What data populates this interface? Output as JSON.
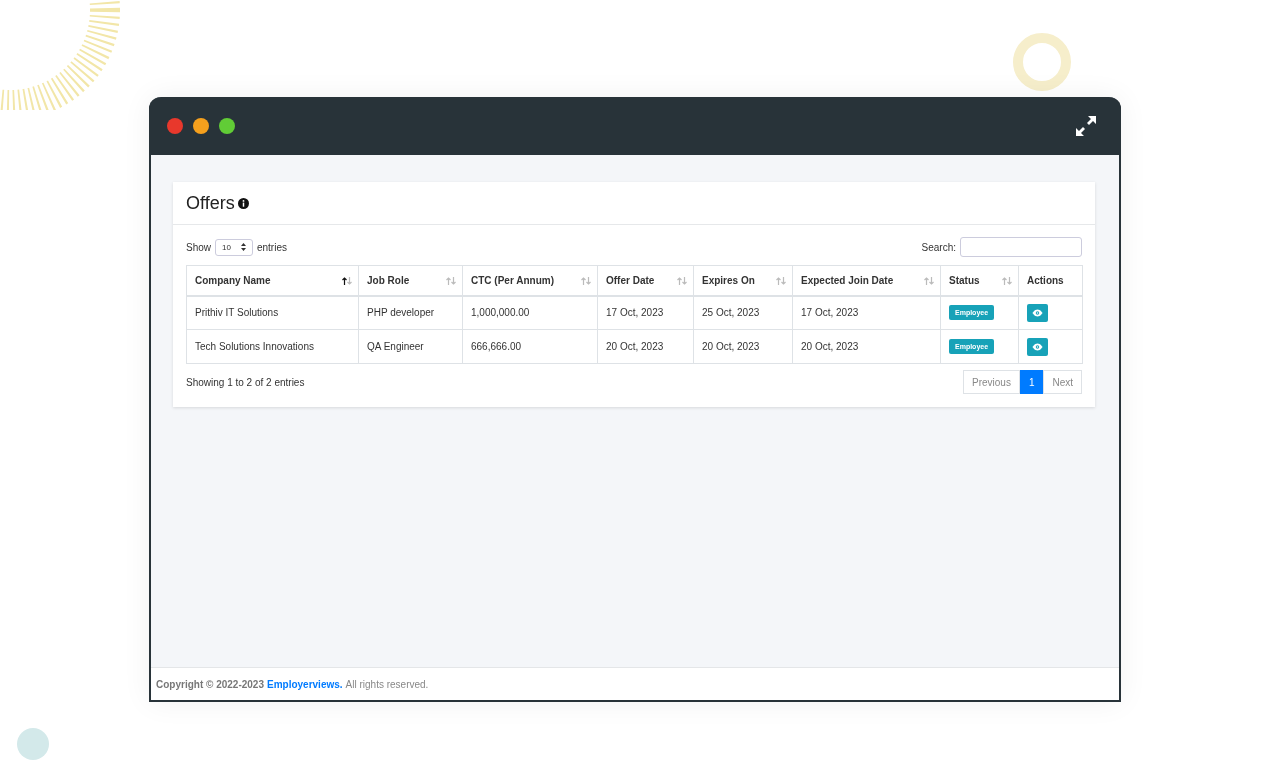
{
  "page": {
    "title": "Offers"
  },
  "length": {
    "show_label": "Show",
    "value": "10",
    "entries_label": "entries"
  },
  "search": {
    "label": "Search:"
  },
  "table": {
    "columns": [
      {
        "label": "Company Name",
        "sorted": true
      },
      {
        "label": "Job Role",
        "sorted": false
      },
      {
        "label": "CTC (Per Annum)",
        "sorted": false
      },
      {
        "label": "Offer Date",
        "sorted": false
      },
      {
        "label": "Expires On",
        "sorted": false
      },
      {
        "label": "Expected Join Date",
        "sorted": false
      },
      {
        "label": "Status",
        "sorted": false
      },
      {
        "label": "Actions"
      }
    ],
    "rows": [
      {
        "cells": [
          "Prithiv IT Solutions",
          "PHP developer",
          "1,000,000.00",
          "17 Oct, 2023",
          "25 Oct, 2023",
          "17 Oct, 2023"
        ],
        "status": "Employee"
      },
      {
        "cells": [
          "Tech Solutions Innovations",
          "QA Engineer",
          "666,666.00",
          "20 Oct, 2023",
          "20 Oct, 2023",
          "20 Oct, 2023"
        ],
        "status": "Employee"
      }
    ]
  },
  "info": "Showing 1 to 2 of 2 entries",
  "pagination": {
    "previous": "Previous",
    "pages": [
      {
        "label": "1",
        "selected": true
      }
    ],
    "next": "Next"
  },
  "footer": {
    "copyright": "Copyright © 2022-2023",
    "link": "Employerviews.",
    "rest": "All rights reserved."
  }
}
